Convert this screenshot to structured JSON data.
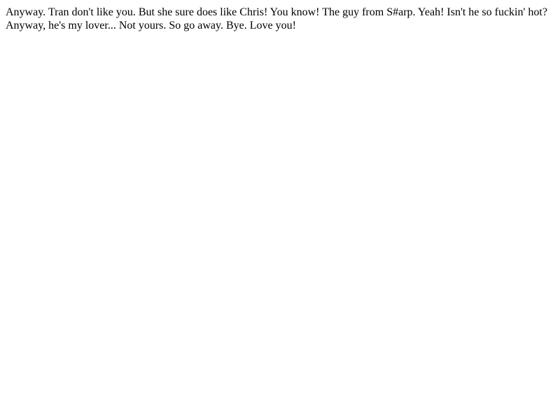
{
  "document": {
    "text": "Anyway. Tran don't like you. But she sure does like Chris! You know! The guy from S#arp. Yeah! Isn't he so fuckin' hot? Anyway, he's my lover... Not yours. So go away. Bye. Love you!"
  }
}
